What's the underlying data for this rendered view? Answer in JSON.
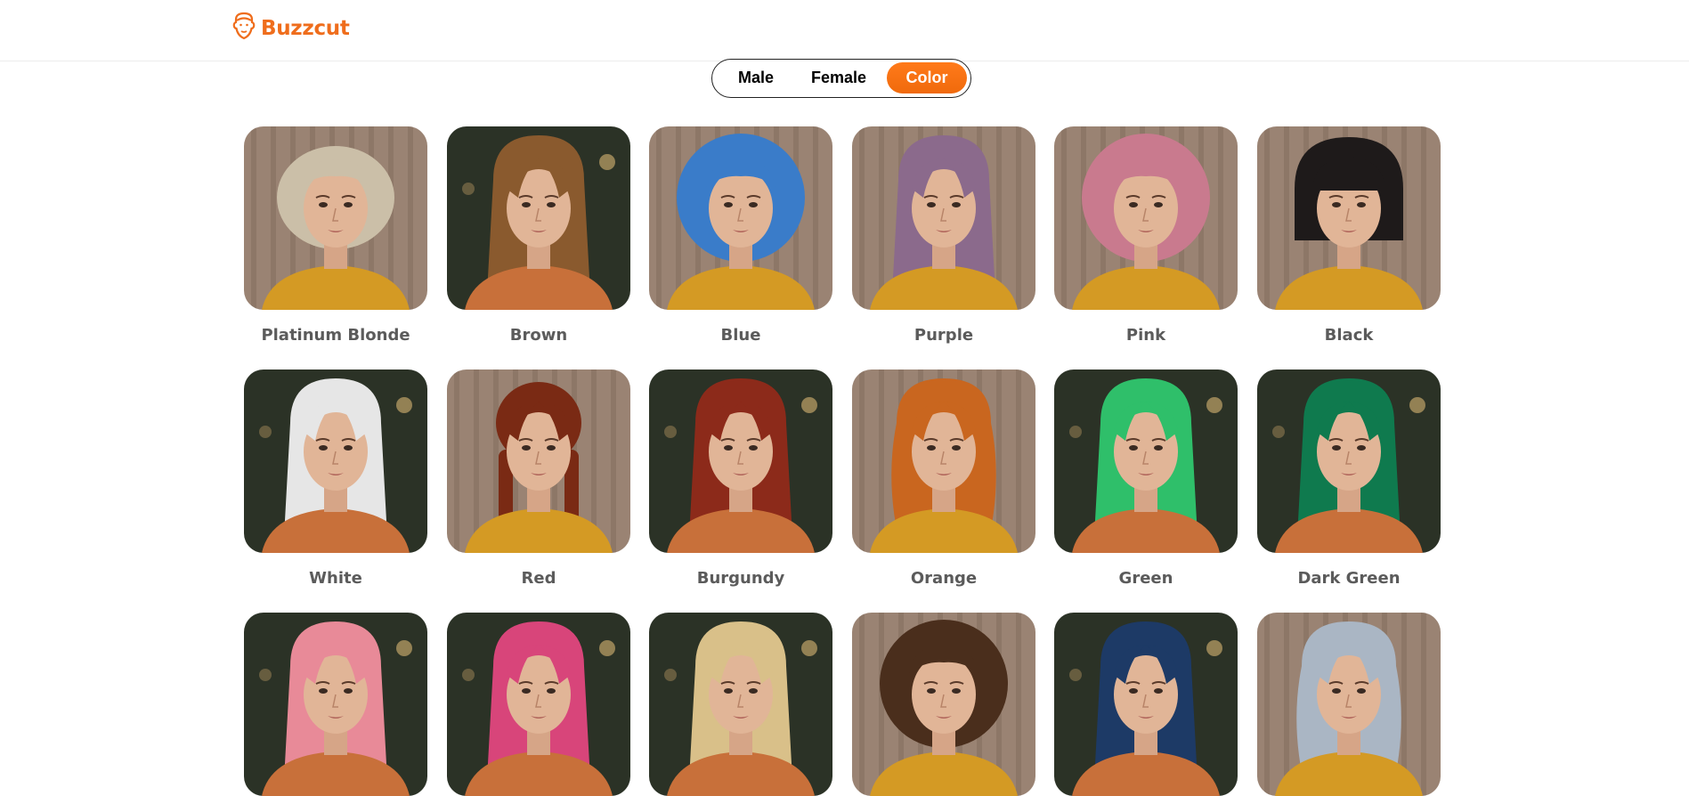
{
  "header": {
    "brand": "Buzzcut",
    "logo_icon": "buzzcut-face-icon",
    "brand_color": "#ef6d1c"
  },
  "tabs": [
    {
      "label": "Male",
      "active": false
    },
    {
      "label": "Female",
      "active": false
    },
    {
      "label": "Color",
      "active": true
    }
  ],
  "accent_color": "#f6710f",
  "styles": [
    {
      "label": "Platinum Blonde",
      "hair": "#cbbfa8",
      "shape": "curly-short",
      "bg": "stripes"
    },
    {
      "label": "Brown",
      "hair": "#8a5a2e",
      "shape": "long",
      "bg": "dark"
    },
    {
      "label": "Blue",
      "hair": "#3a7cc9",
      "shape": "afro",
      "bg": "stripes"
    },
    {
      "label": "Purple",
      "hair": "#8b6a8c",
      "shape": "long",
      "bg": "stripes"
    },
    {
      "label": "Pink",
      "hair": "#c97a8e",
      "shape": "afro",
      "bg": "stripes"
    },
    {
      "label": "Black",
      "hair": "#1e1a1a",
      "shape": "bob",
      "bg": "stripes"
    },
    {
      "label": "White",
      "hair": "#e6e6e6",
      "shape": "long",
      "bg": "dark"
    },
    {
      "label": "Red",
      "hair": "#7a2a14",
      "shape": "braids",
      "bg": "stripes"
    },
    {
      "label": "Burgundy",
      "hair": "#8c2a1a",
      "shape": "long",
      "bg": "dark"
    },
    {
      "label": "Orange",
      "hair": "#c9661f",
      "shape": "wavy",
      "bg": "stripes"
    },
    {
      "label": "Green",
      "hair": "#2fbf6a",
      "shape": "long",
      "bg": "dark"
    },
    {
      "label": "Dark Green",
      "hair": "#0f7a4e",
      "shape": "long",
      "bg": "dark"
    },
    {
      "label": "",
      "hair": "#e88a98",
      "shape": "long",
      "bg": "dark"
    },
    {
      "label": "",
      "hair": "#d8457a",
      "shape": "long",
      "bg": "dark"
    },
    {
      "label": "",
      "hair": "#d9c089",
      "shape": "long",
      "bg": "dark"
    },
    {
      "label": "",
      "hair": "#4a2e1c",
      "shape": "afro",
      "bg": "stripes"
    },
    {
      "label": "",
      "hair": "#1d3a66",
      "shape": "long",
      "bg": "dark"
    },
    {
      "label": "",
      "hair": "#aab6c4",
      "shape": "wavy",
      "bg": "stripes"
    }
  ]
}
